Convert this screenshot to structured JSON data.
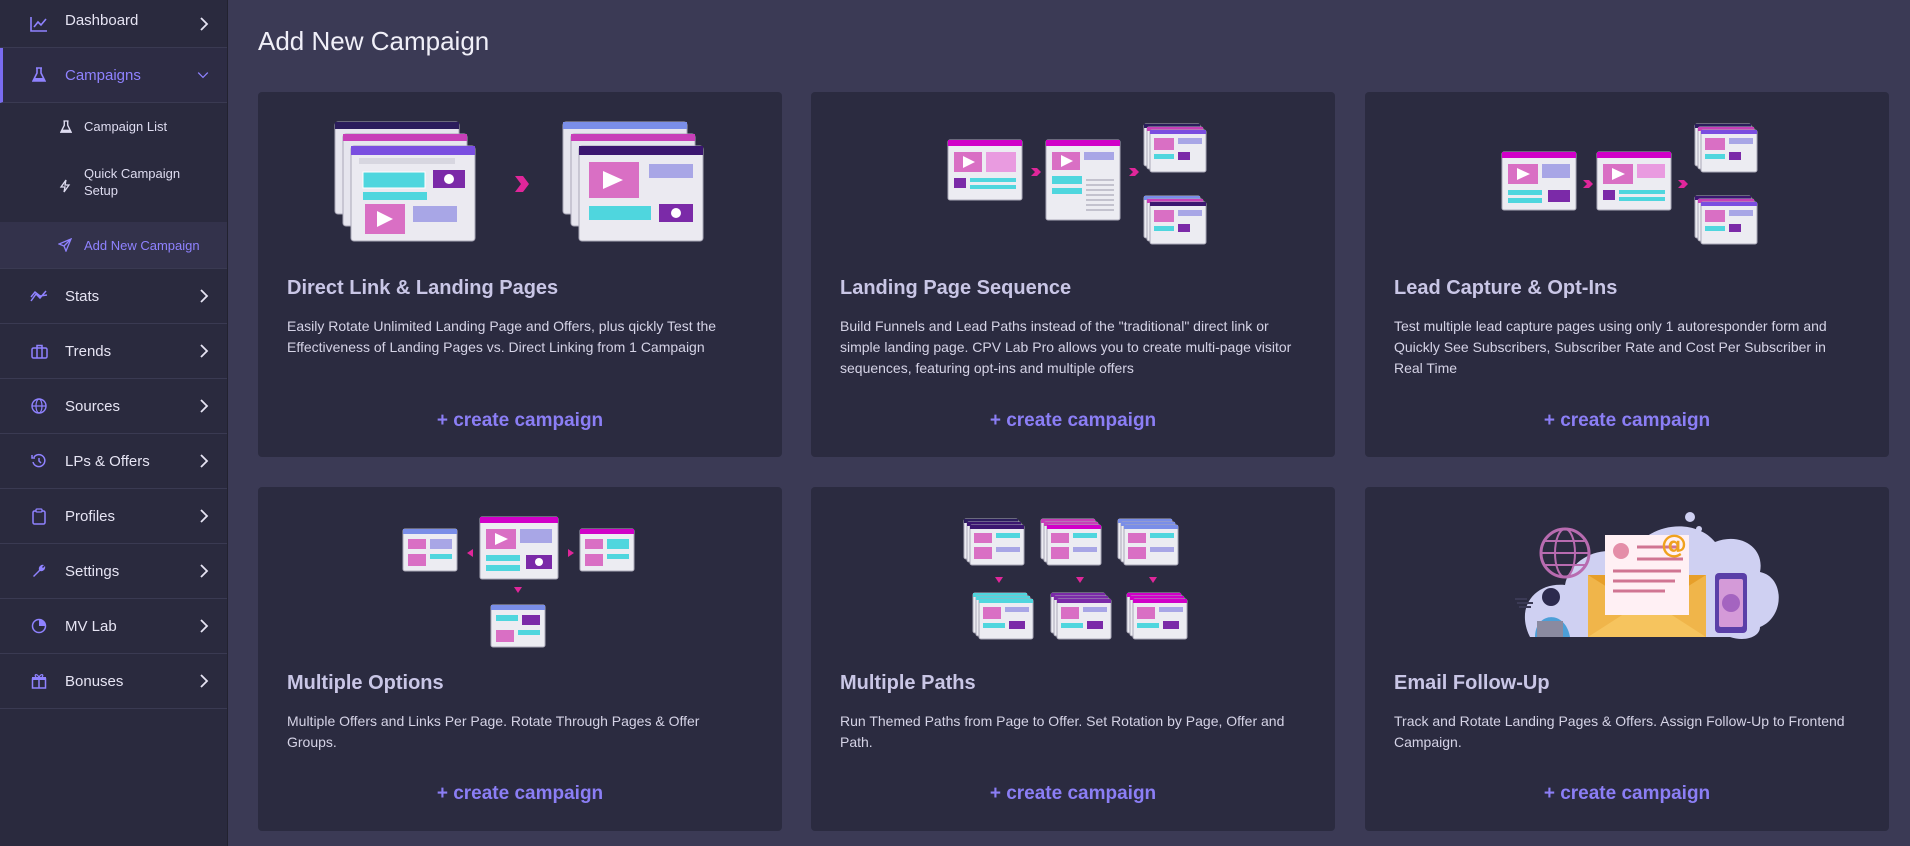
{
  "sidebar": {
    "items": [
      {
        "label": "Dashboard",
        "icon": "chart-line-icon"
      },
      {
        "label": "Campaigns",
        "icon": "flask-icon",
        "expanded": true
      },
      {
        "label": "Stats",
        "icon": "stats-icon"
      },
      {
        "label": "Trends",
        "icon": "briefcase-icon"
      },
      {
        "label": "Sources",
        "icon": "globe-icon"
      },
      {
        "label": "LPs & Offers",
        "icon": "history-icon"
      },
      {
        "label": "Profiles",
        "icon": "clipboard-icon"
      },
      {
        "label": "Settings",
        "icon": "wrench-icon"
      },
      {
        "label": "MV Lab",
        "icon": "pie-icon"
      },
      {
        "label": "Bonuses",
        "icon": "gift-icon"
      }
    ],
    "campaign_sub": [
      {
        "label": "Campaign List",
        "icon": "flask-icon"
      },
      {
        "label": "Quick Campaign Setup",
        "line1": "Quick Campaign",
        "line2": "Setup",
        "icon": "bolt-icon"
      },
      {
        "label": "Add New Campaign",
        "icon": "paper-plane-icon"
      }
    ]
  },
  "page": {
    "title": "Add New Campaign"
  },
  "cards": [
    {
      "title": "Direct Link & Landing Pages",
      "desc": "Easily Rotate Unlimited Landing Page and Offers, plus qickly Test the Effectiveness of Landing Pages vs. Direct Linking from 1 Campaign",
      "button": "+ create campaign"
    },
    {
      "title": "Landing Page Sequence",
      "desc": "Build Funnels and Lead Paths instead of the \"traditional\" direct link or simple landing page. CPV Lab Pro allows you to create multi-page visitor sequences, featuring opt-ins and multiple offers",
      "button": "+ create campaign"
    },
    {
      "title": "Lead Capture & Opt-Ins",
      "desc": "Test multiple lead capture pages using only 1 autoresponder form and Quickly See Subscribers, Subscriber Rate and Cost Per Subscriber in Real Time",
      "button": "+ create campaign"
    },
    {
      "title": "Multiple Options",
      "desc": "Multiple Offers and Links Per Page. Rotate Through Pages & Offer Groups.",
      "button": "+ create campaign"
    },
    {
      "title": "Multiple Paths",
      "desc": "Run Themed Paths from Page to Offer. Set Rotation by Page, Offer and Path.",
      "button": "+ create campaign"
    },
    {
      "title": "Email Follow-Up",
      "desc": "Track and Rotate Landing Pages & Offers. Assign Follow-Up to Frontend Campaign.",
      "button": "+ create campaign"
    }
  ],
  "colors": {
    "accent": "#8b7ef5",
    "sidebar_bg": "#2a2a3e",
    "main_bg": "#3b3a55",
    "card_bg": "#2b2b40",
    "pink": "#d96fc4",
    "cyan": "#4fd6de",
    "purple": "#7b2aa8",
    "magenta": "#d100c8"
  }
}
